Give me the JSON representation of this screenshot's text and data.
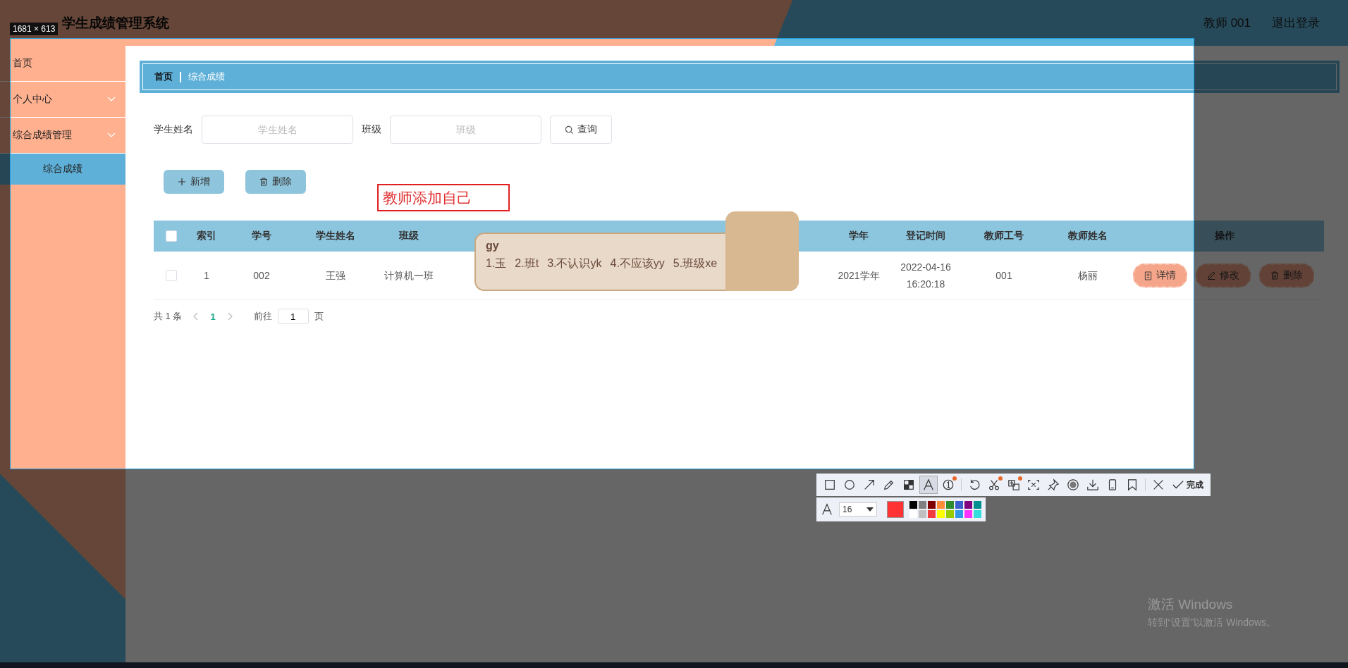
{
  "header": {
    "title": "学生成绩管理系统",
    "user": "教师 001",
    "logout": "退出登录"
  },
  "sidebar": {
    "items": [
      {
        "label": "首页",
        "kind": "link",
        "selected": false
      },
      {
        "label": "个人中心",
        "kind": "group",
        "selected": false
      },
      {
        "label": "综合成绩管理",
        "kind": "group",
        "selected": false,
        "children": [
          {
            "label": "综合成绩",
            "selected": true
          }
        ]
      }
    ]
  },
  "breadcrumb": [
    "首页",
    "综合成绩"
  ],
  "search": {
    "fields": [
      {
        "label": "学生姓名",
        "placeholder": "学生姓名"
      },
      {
        "label": "班级",
        "placeholder": "班级"
      }
    ],
    "button": "查询"
  },
  "actions": [
    {
      "label": "新增",
      "kind": "add"
    },
    {
      "label": "删除",
      "kind": "delete"
    }
  ],
  "annotation": {
    "text": "教师添加自己"
  },
  "table": {
    "header_checked": false,
    "columns": [
      "索引",
      "学号",
      "学生姓名",
      "班级",
      "学年",
      "登记时间",
      "教师工号",
      "教师姓名",
      "操作"
    ],
    "rows": [
      {
        "checked": false,
        "cells": [
          "1",
          "002",
          "王强",
          "计算机一班",
          "2021学年",
          "2022-04-16 16:20:18",
          "001",
          "杨丽"
        ],
        "buttons": [
          {
            "label": "详情",
            "kind": "detail"
          },
          {
            "label": "修改",
            "kind": "edit"
          },
          {
            "label": "删除",
            "kind": "delete"
          }
        ]
      }
    ]
  },
  "pagination": {
    "total": "共 1 条",
    "pages": [
      {
        "label": "1",
        "selected": true
      }
    ],
    "goto_label": "前往",
    "goto_value": "1",
    "unit": "页"
  },
  "ime": {
    "input": "gy",
    "candidates": [
      "1.玉",
      "2.班t",
      "3.不认识yk",
      "4.不应该yy",
      "5.班级xe"
    ]
  },
  "capture": {
    "size_label": "1681 × 613",
    "tool_groups": [
      {
        "tools": [
          {
            "kind": "rect",
            "selected": false,
            "badge": false
          },
          {
            "kind": "circle",
            "selected": false,
            "badge": false
          },
          {
            "kind": "arrow",
            "selected": false,
            "badge": false
          },
          {
            "kind": "pencil",
            "selected": false,
            "badge": false
          },
          {
            "kind": "mosaic",
            "selected": false,
            "badge": false
          },
          {
            "kind": "text",
            "selected": true,
            "badge": false
          },
          {
            "kind": "number",
            "selected": false,
            "badge": true
          }
        ]
      },
      {
        "tools": [
          {
            "kind": "undo",
            "selected": false,
            "badge": false
          },
          {
            "kind": "scissors",
            "selected": false,
            "badge": true
          },
          {
            "kind": "translate",
            "selected": false,
            "badge": true
          },
          {
            "kind": "ocr",
            "selected": false,
            "badge": false
          },
          {
            "kind": "pin",
            "selected": false,
            "badge": false
          },
          {
            "kind": "record",
            "selected": false,
            "badge": false
          },
          {
            "kind": "download",
            "selected": false,
            "badge": false
          },
          {
            "kind": "phone",
            "selected": false,
            "badge": false
          },
          {
            "kind": "bookmark",
            "selected": false,
            "badge": false
          }
        ]
      },
      {
        "tools": [
          {
            "kind": "close",
            "selected": false,
            "badge": false
          }
        ]
      }
    ],
    "finish": "完成",
    "font_size": "16",
    "current_color": {
      "color": "#ff3333"
    },
    "palette": [
      {
        "color": "#000000"
      },
      {
        "color": "#808080"
      },
      {
        "color": "#800000"
      },
      {
        "color": "#ff8c3a"
      },
      {
        "color": "#2e8b2e"
      },
      {
        "color": "#3a5fcd"
      },
      {
        "color": "#800080"
      },
      {
        "color": "#009090"
      },
      {
        "color": "#ffffff"
      },
      {
        "color": "#c0c0c0"
      },
      {
        "color": "#f03c3c"
      },
      {
        "color": "#ffff00"
      },
      {
        "color": "#99cc00"
      },
      {
        "color": "#3399e6"
      },
      {
        "color": "#ff33ff"
      },
      {
        "color": "#33dddd"
      }
    ]
  },
  "watermark": {
    "title": "激活 Windows",
    "subtitle": "转到“设置”以激活 Windows。"
  }
}
